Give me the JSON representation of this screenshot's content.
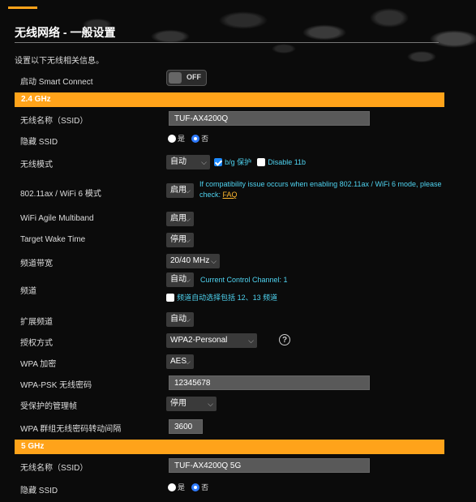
{
  "page": {
    "title": "无线网络 - 一般设置",
    "subtitle": "设置以下无线相关信息。"
  },
  "smart_connect": {
    "label": "启动 Smart Connect",
    "state": "OFF"
  },
  "band24": {
    "header": "2.4 GHz",
    "ssid_label": "无线名称（SSID）",
    "ssid_value": "TUF-AX4200Q",
    "hide_ssid_label": "隐藏 SSID",
    "radio_yes": "是",
    "radio_no": "否",
    "hide_ssid_selected": "否",
    "mode_label": "无线模式",
    "mode_value": "自动",
    "bg_protect_label": "b/g 保护",
    "bg_protect_checked": true,
    "disable11b_label": "Disable 11b",
    "disable11b_checked": false,
    "wifi6_label": "802.11ax / WiFi 6 模式",
    "wifi6_value": "启用",
    "wifi6_note": "If compatibility issue occurs when enabling 802.11ax / WiFi 6 mode, please check:",
    "faq_label": "FAQ",
    "multiband_label": "WiFi Agile Multiband",
    "multiband_value": "启用",
    "twt_label": "Target Wake Time",
    "twt_value": "停用",
    "bandwidth_label": "频道带宽",
    "bandwidth_value": "20/40 MHz",
    "channel_label": "频道",
    "channel_value": "自动",
    "current_channel": "Current Control Channel: 1",
    "auto_channel_note": "频道自动选择包括 12、13 频道",
    "auto_channel_checked": false,
    "ext_channel_label": "扩展频道",
    "ext_channel_value": "自动",
    "auth_label": "授权方式",
    "auth_value": "WPA2-Personal",
    "help_icon": "?",
    "wpa_enc_label": "WPA 加密",
    "wpa_enc_value": "AES",
    "psk_label": "WPA-PSK 无线密码",
    "psk_value": "12345678",
    "pmf_label": "受保护的管理帧",
    "pmf_value": "停用",
    "rekey_label": "WPA 群组无线密码转动间隔",
    "rekey_value": "3600"
  },
  "band5": {
    "header": "5 GHz",
    "ssid_label": "无线名称（SSID）",
    "ssid_value": "TUF-AX4200Q 5G",
    "hide_ssid_label": "隐藏 SSID",
    "radio_yes": "是",
    "radio_no": "否",
    "hide_ssid_selected": "否"
  },
  "colors": {
    "accent": "#ffa31a",
    "info": "#4fd3f0",
    "link": "#ffb82e"
  }
}
